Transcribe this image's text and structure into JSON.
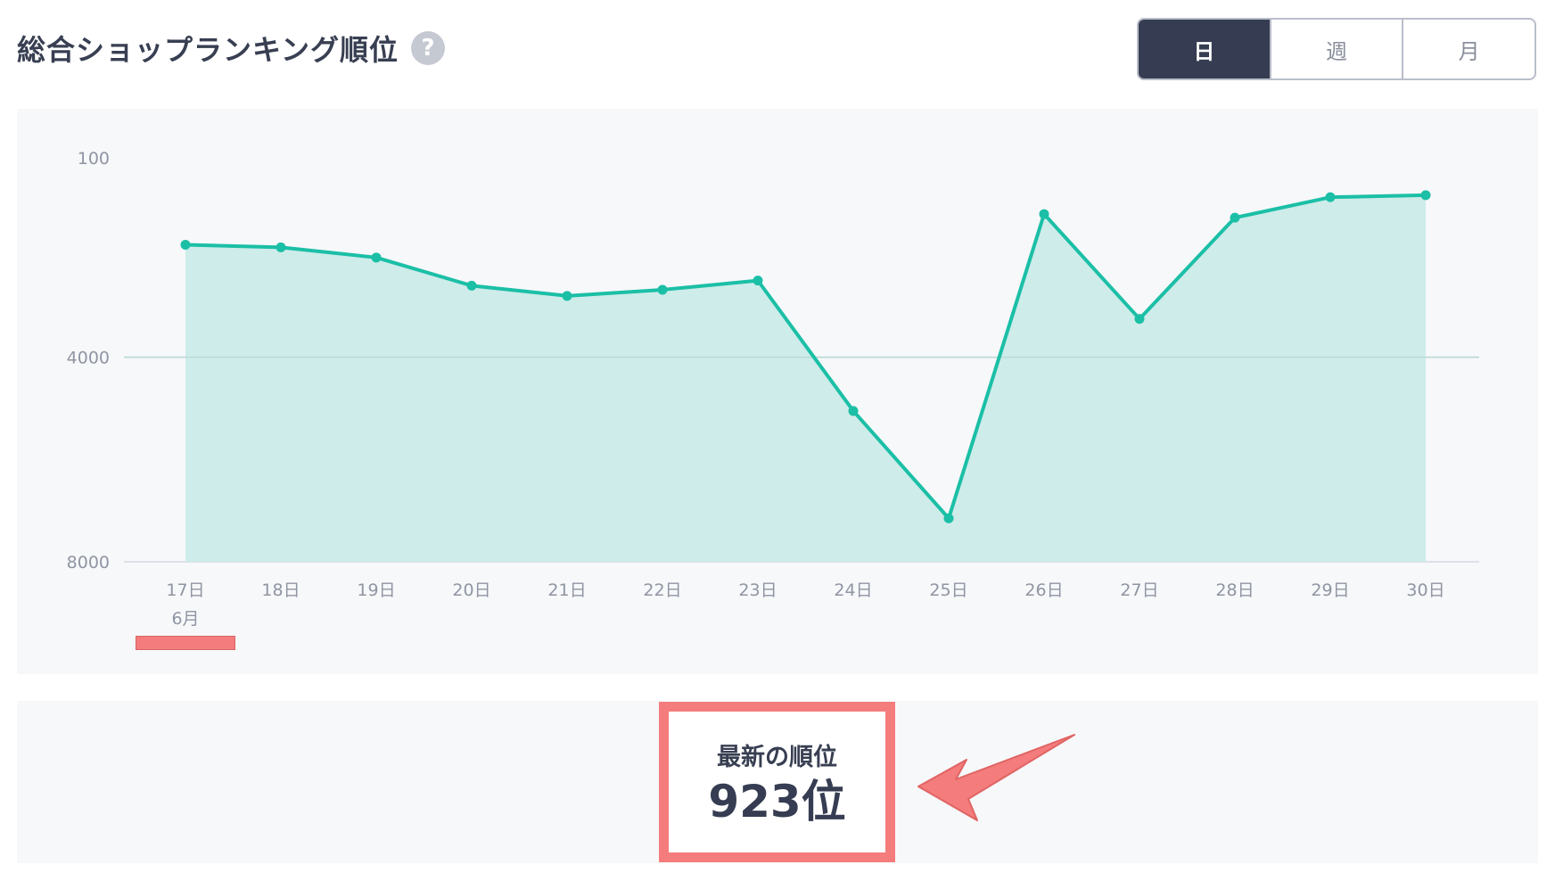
{
  "header": {
    "title": "総合ショップランキング順位",
    "help_icon_glyph": "?",
    "help_icon_name": "question-circle-icon"
  },
  "period_toggle": {
    "options": [
      "日",
      "週",
      "月"
    ],
    "selected": "日"
  },
  "chart_data": {
    "type": "area",
    "x": [
      "17日",
      "18日",
      "19日",
      "20日",
      "21日",
      "22日",
      "23日",
      "24日",
      "25日",
      "26日",
      "27日",
      "28日",
      "29日",
      "30日"
    ],
    "month_label": "6月",
    "series": [
      {
        "values": [
          1800,
          1850,
          2050,
          2600,
          2800,
          2680,
          2500,
          5050,
          7150,
          1200,
          3250,
          1270,
          870,
          830
        ]
      }
    ],
    "y_ticks": [
      100,
      4000,
      8000
    ],
    "ylim": [
      100,
      8000
    ],
    "y_inverted": true,
    "grid": true,
    "colors": {
      "line": "#1bbfa6",
      "fill": "#cdecea",
      "grid": "#dde0e5"
    }
  },
  "summary": {
    "latest_label": "最新の順位",
    "latest_value": "923位"
  },
  "annotation": {
    "highlight_color": "#f47c7c"
  }
}
